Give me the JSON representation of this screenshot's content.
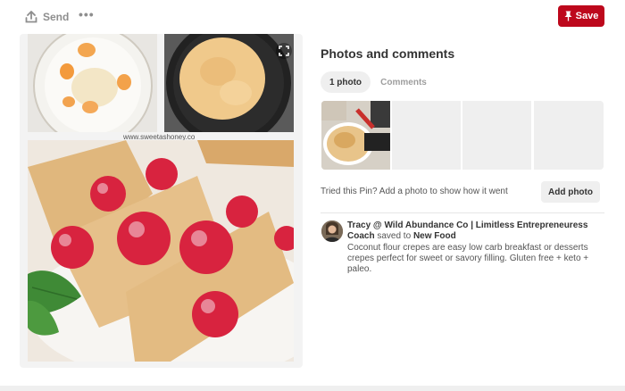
{
  "toolbar": {
    "send_label": "Send",
    "more_label": "•••",
    "save_label": "Save",
    "send_icon": "upload-icon",
    "save_icon": "pin-icon",
    "accent_color": "#bd081c"
  },
  "images": {
    "watermark": "www.sweetashoney.co"
  },
  "panel": {
    "title": "Photos and comments",
    "tabs": [
      {
        "label": "1 photo",
        "selected": true
      },
      {
        "label": "Comments",
        "selected": false
      }
    ],
    "tried_text": "Tried this Pin? Add a photo to show how it went",
    "add_photo_label": "Add photo"
  },
  "comment": {
    "author": "Tracy @ Wild Abundance Co | Limitless Entrepreneuress Coach",
    "saved_to": "saved to",
    "board": "New Food",
    "description": "Coconut flour crepes are easy low carb breakfast or desserts crepes perfect for sweet or savory filling. Gluten free + keto + paleo."
  }
}
